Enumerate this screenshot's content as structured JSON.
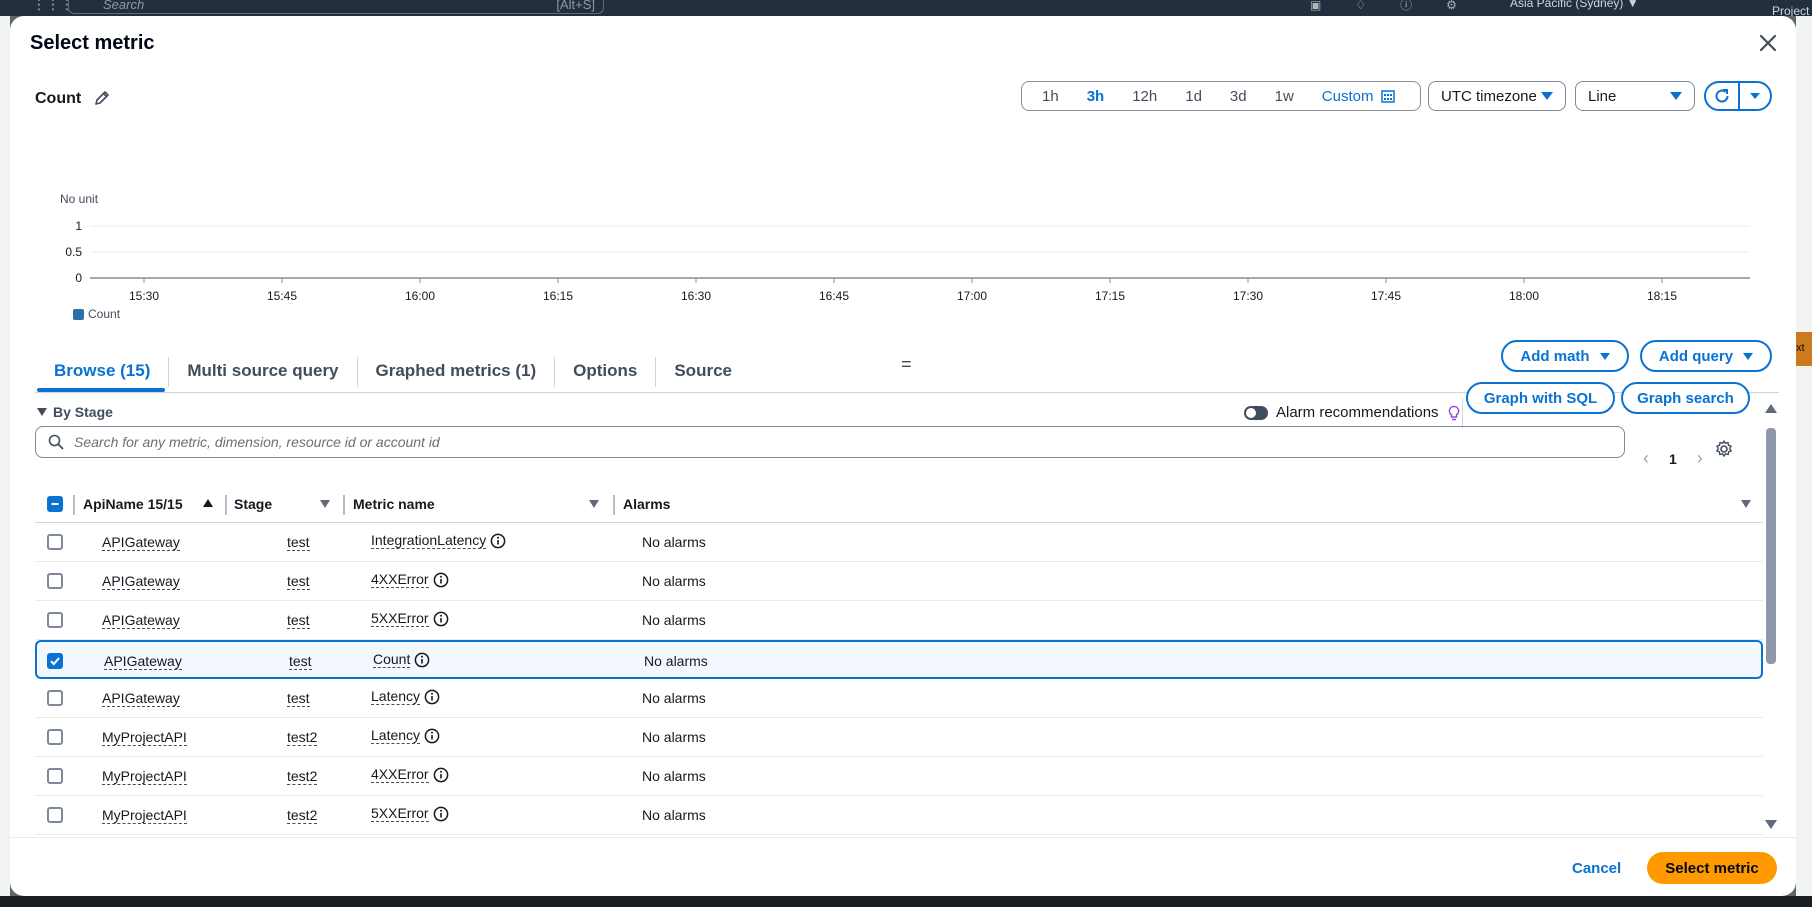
{
  "background": {
    "search_placeholder": "Search",
    "search_shortcut": "[Alt+S]",
    "region": "Asia Pacific (Sydney) ▼",
    "project": "Project",
    "ext_badge": "xt"
  },
  "modal": {
    "title": "Select metric",
    "metric_title": "Count"
  },
  "time_range": {
    "options": [
      "1h",
      "3h",
      "12h",
      "1d",
      "3d",
      "1w",
      "Custom"
    ],
    "active": "3h"
  },
  "timezone": {
    "value": "UTC timezone"
  },
  "chart_type": {
    "value": "Line"
  },
  "chart_data": {
    "type": "line",
    "ylabel": "No unit",
    "yticks": [
      "1",
      "0.5",
      "0"
    ],
    "ylim": [
      0,
      1
    ],
    "xticks": [
      "15:30",
      "15:45",
      "16:00",
      "16:15",
      "16:30",
      "16:45",
      "17:00",
      "17:15",
      "17:30",
      "17:45",
      "18:00",
      "18:15"
    ],
    "series": [
      {
        "name": "Count",
        "values": []
      }
    ],
    "legend": "bottom-left",
    "color": "#2e6fa7"
  },
  "tabs": [
    {
      "label": "Browse (15)"
    },
    {
      "label": "Multi source query"
    },
    {
      "label": "Graphed metrics (1)"
    },
    {
      "label": "Options"
    },
    {
      "label": "Source"
    }
  ],
  "actions": {
    "add_math": "Add math",
    "add_query": "Add query",
    "graph_sql": "Graph with SQL",
    "graph_search": "Graph search",
    "alarm_recs": "Alarm recommendations"
  },
  "browse": {
    "group": "By Stage",
    "search_placeholder": "Search for any metric, dimension, resource id or account id",
    "page": "1"
  },
  "table": {
    "columns": [
      "ApiName 15/15",
      "Stage",
      "Metric name",
      "Alarms"
    ],
    "rows": [
      {
        "api": "APIGateway",
        "stage": "test",
        "metric": "IntegrationLatency",
        "alarms": "No alarms",
        "checked": false
      },
      {
        "api": "APIGateway",
        "stage": "test",
        "metric": "4XXError",
        "alarms": "No alarms",
        "checked": false
      },
      {
        "api": "APIGateway",
        "stage": "test",
        "metric": "5XXError",
        "alarms": "No alarms",
        "checked": false
      },
      {
        "api": "APIGateway",
        "stage": "test",
        "metric": "Count",
        "alarms": "No alarms",
        "checked": true
      },
      {
        "api": "APIGateway",
        "stage": "test",
        "metric": "Latency",
        "alarms": "No alarms",
        "checked": false
      },
      {
        "api": "MyProjectAPI",
        "stage": "test2",
        "metric": "Latency",
        "alarms": "No alarms",
        "checked": false
      },
      {
        "api": "MyProjectAPI",
        "stage": "test2",
        "metric": "4XXError",
        "alarms": "No alarms",
        "checked": false
      },
      {
        "api": "MyProjectAPI",
        "stage": "test2",
        "metric": "5XXError",
        "alarms": "No alarms",
        "checked": false
      }
    ]
  },
  "footer": {
    "cancel": "Cancel",
    "select": "Select metric"
  },
  "colors": {
    "accent": "#0972d3",
    "primary": "#ff9900",
    "series": "#2e6fa7"
  }
}
